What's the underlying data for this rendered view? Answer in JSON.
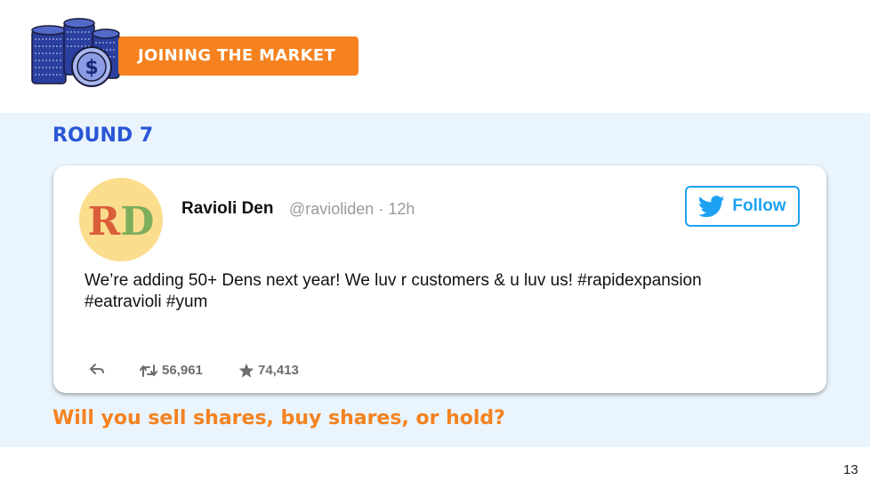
{
  "header": {
    "banner_label": "JOINING THE MARKET",
    "logo_icon": "coin-stack-dollar-icon"
  },
  "round_label": "ROUND 7",
  "tweet": {
    "avatar_text": "RD",
    "name": "Ravioli Den",
    "handle": "@ravioliden · 12h",
    "follow_label": "Follow",
    "text": "We’re adding 50+ Dens next year! We luv r customers & u luv us! #rapidexpansion #eatravioli #yum",
    "retweets": "56,961",
    "likes": "74,413"
  },
  "question": "Will you sell shares, buy shares, or hold?",
  "page_number": "13",
  "colors": {
    "accent_orange": "#f5821f",
    "round_blue": "#2a56d6",
    "band_bg": "#e9f4fd",
    "twitter_blue": "#1da1f2"
  }
}
